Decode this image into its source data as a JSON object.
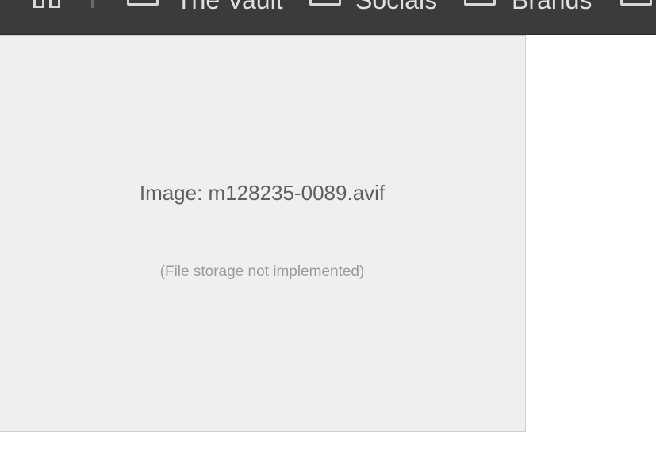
{
  "toolbar": {
    "items": [
      {
        "label": "The Vault",
        "icon": "folder-icon"
      },
      {
        "label": "Socials",
        "icon": "folder-icon"
      },
      {
        "label": "Brands",
        "icon": "folder-icon"
      },
      {
        "label": "",
        "icon": "folder-icon"
      }
    ],
    "grid_icon": "grid-icon",
    "background": "#3b3b3b"
  },
  "viewer": {
    "file_label": "Image: m128235-0089.avif",
    "note": "(File storage not implemented)",
    "background": "#efefef"
  }
}
